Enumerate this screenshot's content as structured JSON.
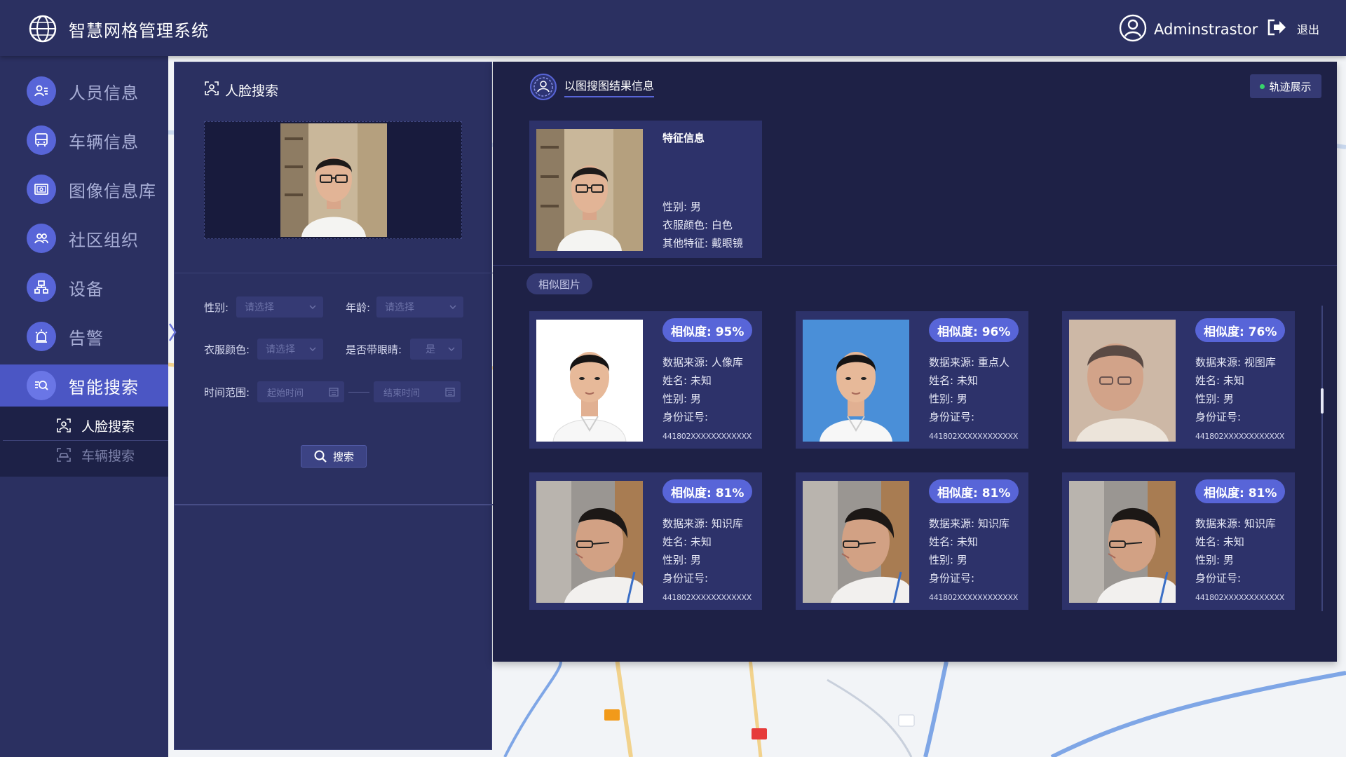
{
  "header": {
    "title": "智慧网格管理系统",
    "user_name": "Adminstrastor",
    "logout_label": "退出"
  },
  "sidebar": {
    "items": [
      {
        "label": "人员信息",
        "icon": "person-list-icon"
      },
      {
        "label": "车辆信息",
        "icon": "bus-icon"
      },
      {
        "label": "图像信息库",
        "icon": "image-library-icon"
      },
      {
        "label": "社区组织",
        "icon": "group-icon"
      },
      {
        "label": "设备",
        "icon": "device-network-icon"
      },
      {
        "label": "告警",
        "icon": "alarm-icon"
      },
      {
        "label": "智能搜索",
        "icon": "smart-search-icon"
      }
    ],
    "sub_items": [
      {
        "label": "人脸搜索",
        "icon": "face-scan-icon"
      },
      {
        "label": "车辆搜索",
        "icon": "car-scan-icon"
      }
    ]
  },
  "search_panel": {
    "title": "人脸搜索",
    "gender_label": "性别:",
    "gender_placeholder": "请选择",
    "age_label": "年龄:",
    "age_placeholder": "请选择",
    "clothes_label": "衣服颜色:",
    "clothes_placeholder": "请选择",
    "glasses_label": "是否带眼睛:",
    "glasses_value": "是",
    "time_label": "时间范围:",
    "start_placeholder": "起始时间",
    "end_placeholder": "结束时间",
    "search_button": "搜索"
  },
  "results": {
    "title": "以图搜图结果信息",
    "track_button": "轨迹展示",
    "feature": {
      "title": "特征信息",
      "gender": "性别: 男",
      "clothes": "衣服颜色: 白色",
      "other": "其他特征: 戴眼镜"
    },
    "similar_tag": "相似图片",
    "cards": [
      {
        "similarity": "相似度: 95%",
        "source": "数据来源: 人像库",
        "name": "姓名: 未知",
        "gender": "性别: 男",
        "id_label": "身份证号:",
        "id_no": "441802XXXXXXXXXXXX",
        "photo": "white"
      },
      {
        "similarity": "相似度: 96%",
        "source": "数据来源: 重点人",
        "name": "姓名: 未知",
        "gender": "性别: 男",
        "id_label": "身份证号:",
        "id_no": "441802XXXXXXXXXXXX",
        "photo": "blue"
      },
      {
        "similarity": "相似度: 76%",
        "source": "数据来源: 视图库",
        "name": "姓名: 未知",
        "gender": "性别: 男",
        "id_label": "身份证号:",
        "id_no": "441802XXXXXXXXXXXX",
        "photo": "blur"
      },
      {
        "similarity": "相似度: 81%",
        "source": "数据来源: 知识库",
        "name": "姓名: 未知",
        "gender": "性别: 男",
        "id_label": "身份证号:",
        "id_no": "441802XXXXXXXXXXXX",
        "photo": "side"
      },
      {
        "similarity": "相似度: 81%",
        "source": "数据来源: 知识库",
        "name": "姓名: 未知",
        "gender": "性别: 男",
        "id_label": "身份证号:",
        "id_no": "441802XXXXXXXXXXXX",
        "photo": "side"
      },
      {
        "similarity": "相似度: 81%",
        "source": "数据来源: 知识库",
        "name": "姓名: 未知",
        "gender": "性别: 男",
        "id_label": "身份证号:",
        "id_no": "441802XXXXXXXXXXXX",
        "photo": "side"
      }
    ]
  },
  "colors": {
    "header_bg": "#2b3061",
    "panel_bg": "#1e2146",
    "accent": "#5865d8",
    "active_nav": "#4b56c4"
  }
}
